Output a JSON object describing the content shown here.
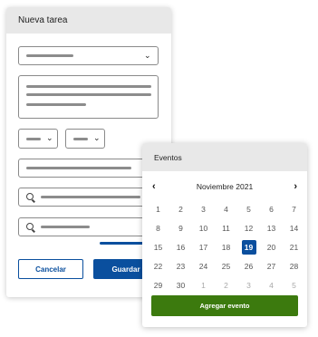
{
  "task_panel": {
    "title": "Nueva tarea",
    "cancel_label": "Cancelar",
    "save_label": "Guardar"
  },
  "events_panel": {
    "title": "Eventos",
    "prev_glyph": "‹",
    "next_glyph": "›",
    "month_label": "Noviembre 2021",
    "weeks": [
      [
        "1",
        "2",
        "3",
        "4",
        "5",
        "6",
        "7"
      ],
      [
        "8",
        "9",
        "10",
        "11",
        "12",
        "13",
        "14"
      ],
      [
        "15",
        "16",
        "17",
        "18",
        "19",
        "20",
        "21"
      ],
      [
        "22",
        "23",
        "24",
        "25",
        "26",
        "27",
        "28"
      ],
      [
        "29",
        "30",
        "1",
        "2",
        "3",
        "4",
        "5"
      ]
    ],
    "selected_day": "19",
    "add_event_label": "Agregar evento"
  },
  "icons": {
    "dropdown": "chevron-down-icon",
    "search": "search-icon"
  },
  "colors": {
    "primary_blue": "#0a4f9e",
    "success_green": "#3c7a0e",
    "header_gray": "#e8e8e8"
  }
}
